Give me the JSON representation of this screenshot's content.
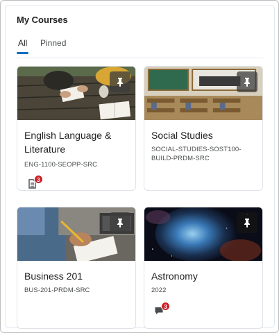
{
  "widget": {
    "title": "My Courses"
  },
  "tabs": [
    {
      "label": "All",
      "active": true
    },
    {
      "label": "Pinned",
      "active": false
    }
  ],
  "courses": [
    {
      "name": "English Language & Literature",
      "code": "ENG-1100-SEOPP-SRC",
      "image": "students-reading-outdoors",
      "notification_icon": "assignments-icon",
      "notification_count": "3"
    },
    {
      "name": "Social Studies",
      "code": "SOCIAL-STUDIES-SOST100-BUILD-PRDM-SRC",
      "image": "classroom"
    },
    {
      "name": "Business 201",
      "code": "BUS-201-PRDM-SRC",
      "image": "person-writing-notes"
    },
    {
      "name": "Astronomy",
      "code": "2022",
      "image": "nebula",
      "notification_icon": "discussions-icon",
      "notification_count": "3"
    }
  ],
  "colors": {
    "accent": "#006fbf",
    "badge": "#cd2026",
    "border": "#dfe3e8"
  }
}
